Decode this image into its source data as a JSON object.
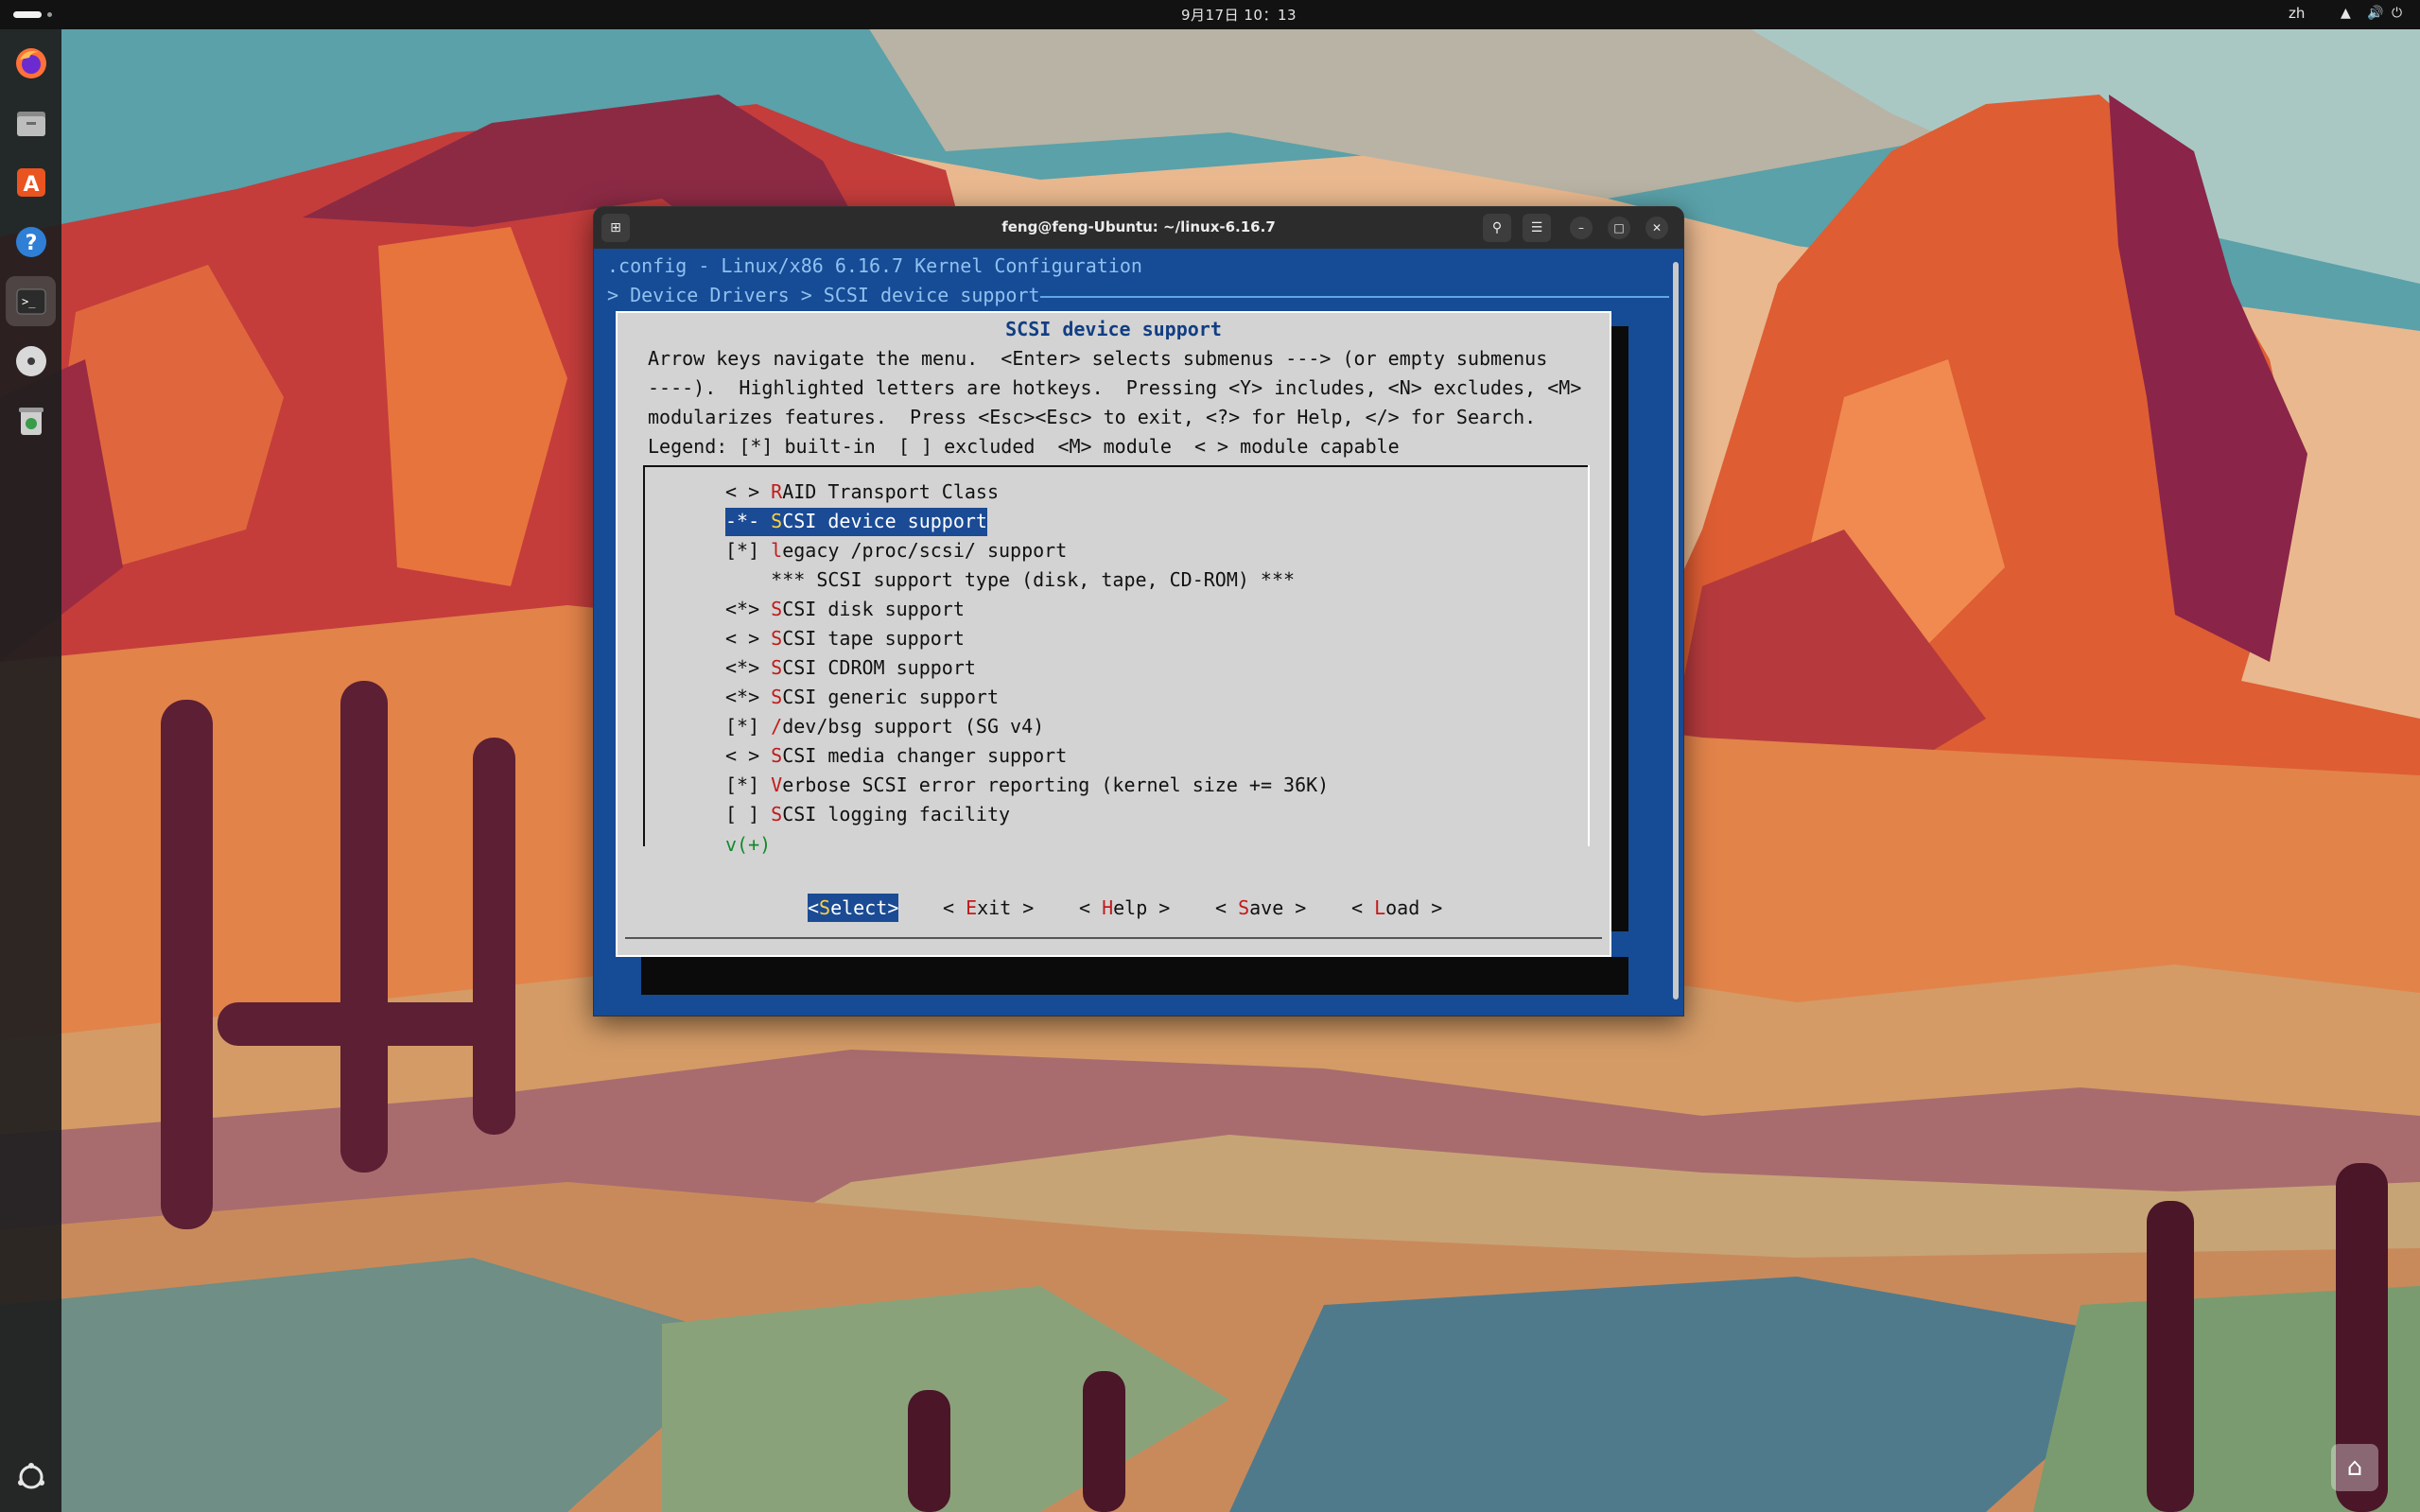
{
  "topbar": {
    "clock": "9月17日 10：13",
    "language": "zh",
    "tray_icons": [
      "network-icon",
      "volume-icon",
      "power-icon"
    ]
  },
  "dock": {
    "items": [
      {
        "name": "firefox-icon",
        "color": "#ff7139"
      },
      {
        "name": "files-icon",
        "color": "#9b9b9b"
      },
      {
        "name": "app-center-icon",
        "color": "#e95420"
      },
      {
        "name": "help-icon",
        "color": "#2f7fd6"
      },
      {
        "name": "terminal-icon",
        "color": "#2b2b2b"
      },
      {
        "name": "disc-icon",
        "color": "#d9d9d9"
      },
      {
        "name": "trash-icon",
        "color": "#cfcfcf"
      }
    ],
    "show_apps": "show-apps-icon"
  },
  "window": {
    "title": "feng@feng-Ubuntu: ~/linux-6.16.7",
    "buttons": [
      "new-tab-icon",
      "search-icon",
      "menu-icon",
      "minimize-icon",
      "maximize-icon",
      "close-icon"
    ]
  },
  "menuconfig": {
    "header": ".config - Linux/x86 6.16.7 Kernel Configuration",
    "breadcrumb": "> Device Drivers > SCSI device support",
    "dialog_title": "SCSI device support",
    "help_lines": [
      "Arrow keys navigate the menu.  <Enter> selects submenus ---> (or empty submenus",
      "----).  Highlighted letters are hotkeys.  Pressing <Y> includes, <N> excludes, <M>",
      "modularizes features.  Press <Esc><Esc> to exit, <?> for Help, </> for Search.",
      "Legend: [*] built-in  [ ] excluded  <M> module  < > module capable"
    ],
    "items": [
      {
        "prefix": "< > ",
        "hotkey": "R",
        "rest": "AID Transport Class",
        "selected": false
      },
      {
        "prefix": "-*- ",
        "hotkey": "S",
        "rest": "CSI device support",
        "selected": true
      },
      {
        "prefix": "[*] ",
        "hotkey": "l",
        "rest": "egacy /proc/scsi/ support",
        "selected": false
      },
      {
        "prefix": "    ",
        "hotkey": "",
        "rest": "*** SCSI support type (disk, tape, CD-ROM) ***",
        "selected": false
      },
      {
        "prefix": "<*> ",
        "hotkey": "S",
        "rest": "CSI disk support",
        "selected": false
      },
      {
        "prefix": "< > ",
        "hotkey": "S",
        "rest": "CSI tape support",
        "selected": false
      },
      {
        "prefix": "<*> ",
        "hotkey": "S",
        "rest": "CSI CDROM support",
        "selected": false
      },
      {
        "prefix": "<*> ",
        "hotkey": "S",
        "rest": "CSI generic support",
        "selected": false
      },
      {
        "prefix": "[*] ",
        "hotkey": "/",
        "rest": "dev/bsg support (SG v4)",
        "selected": false
      },
      {
        "prefix": "< > ",
        "hotkey": "S",
        "rest": "CSI media changer support",
        "selected": false
      },
      {
        "prefix": "[*] ",
        "hotkey": "V",
        "rest": "erbose SCSI error reporting (kernel size += 36K)",
        "selected": false
      },
      {
        "prefix": "[ ] ",
        "hotkey": "S",
        "rest": "CSI logging facility",
        "selected": false
      }
    ],
    "more_indicator": "v(+)",
    "buttons": [
      {
        "left": "<",
        "hotkey": "S",
        "rest": "elect",
        "right": ">",
        "selected": true
      },
      {
        "left": "< ",
        "hotkey": "E",
        "rest": "xit",
        "right": " >",
        "selected": false
      },
      {
        "left": "< ",
        "hotkey": "H",
        "rest": "elp",
        "right": " >",
        "selected": false
      },
      {
        "left": "< ",
        "hotkey": "S",
        "rest": "ave",
        "right": " >",
        "selected": false
      },
      {
        "left": "< ",
        "hotkey": "L",
        "rest": "oad",
        "right": " >",
        "selected": false
      }
    ]
  },
  "colors": {
    "console_bg": "#164b95",
    "dialog_bg": "#d3d3d3",
    "selection": "#1a4b94",
    "hotkey": "#c21b1b",
    "header_text": "#8fc1f0"
  }
}
